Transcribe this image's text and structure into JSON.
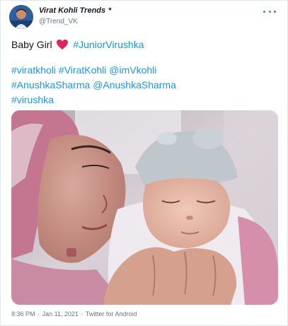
{
  "author": {
    "display_name": "Virat Kohli Trends",
    "star": "*",
    "handle": "@Trend_VK"
  },
  "tweet": {
    "line1_text": "Baby Girl",
    "line1_hashtag": "#JuniorVirushka",
    "tags_line1": [
      "#viratkholi",
      "#ViratKohli",
      "@imVkohli"
    ],
    "tags_line2": [
      "#AnushkaSharma",
      "@AnushkaSharma"
    ],
    "tags_line3": [
      "#virushka"
    ]
  },
  "footer": {
    "time": "8:36 PM",
    "separator": "·",
    "date": "Jan 11, 2021",
    "source": "Twitter for Android"
  },
  "icons": {
    "heart": "heart-emoji-icon",
    "more": "more-options-icon"
  },
  "colors": {
    "link": "#1b95e0",
    "text": "#14171a",
    "secondary": "#657786",
    "heart": "#e0245e"
  }
}
